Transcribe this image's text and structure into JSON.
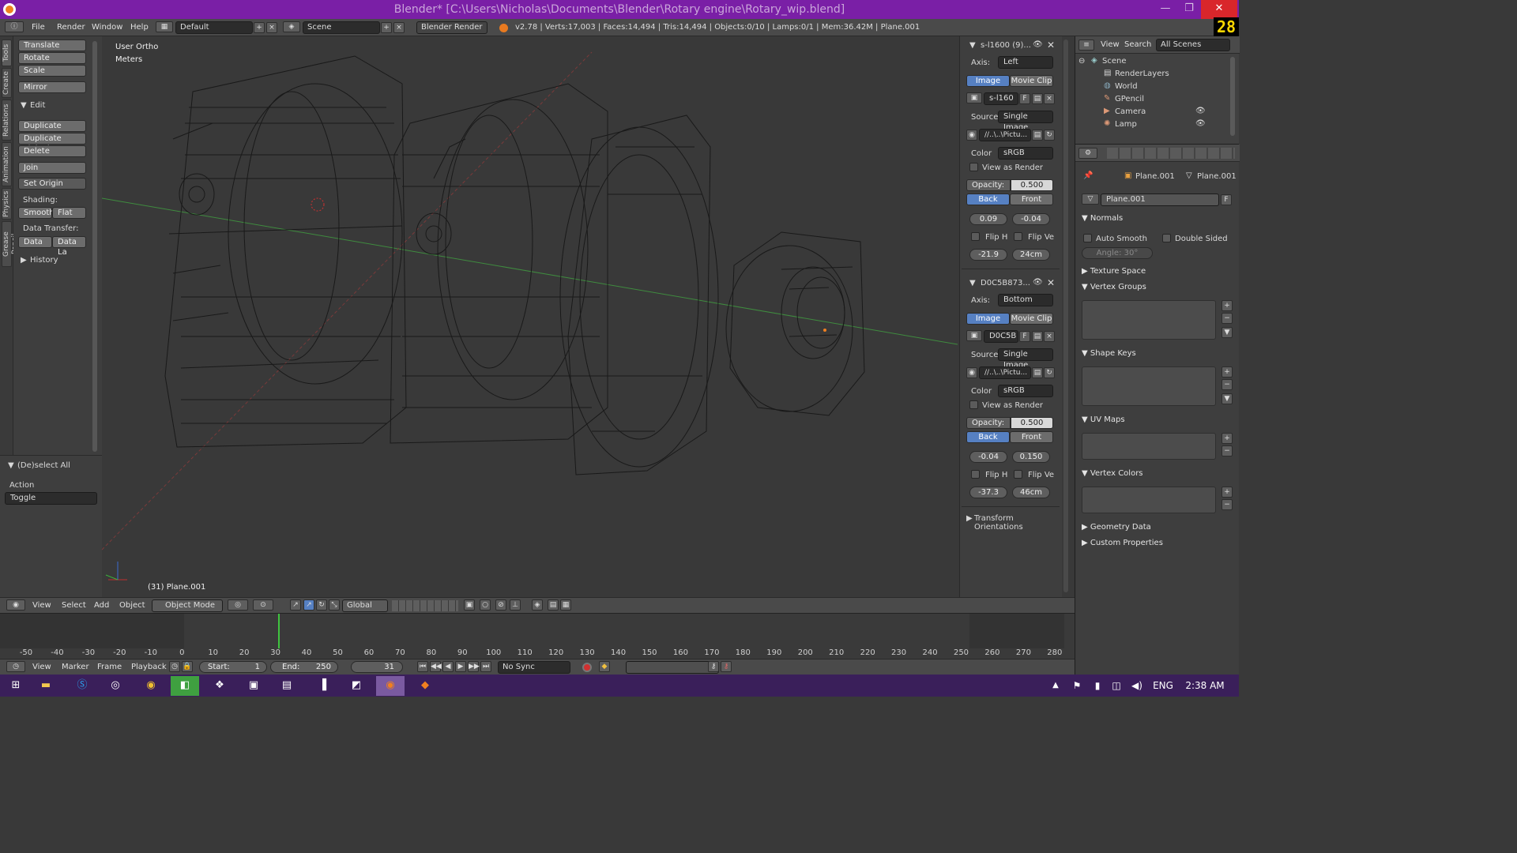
{
  "window": {
    "title": "Blender* [C:\\Users\\Nicholas\\Documents\\Blender\\Rotary engine\\Rotary_wip.blend]",
    "minimize": "—",
    "maximize": "❐",
    "close": "✕"
  },
  "infobar": {
    "menus": [
      "File",
      "Render",
      "Window",
      "Help"
    ],
    "layout": "Default",
    "scene": "Scene",
    "engine": "Blender Render",
    "stats": "v2.78 | Verts:17,003 | Faces:14,494 | Tris:14,494 | Objects:0/10 | Lamps:0/1 | Mem:36.42M | Plane.001",
    "fps": "28"
  },
  "vtabs": [
    "Tools",
    "Create",
    "Relations",
    "Animation",
    "Physics",
    "Grease Pencil"
  ],
  "toolshelf": {
    "transform": [
      "Translate",
      "Rotate",
      "Scale"
    ],
    "mirror": "Mirror",
    "edit_header": "Edit",
    "edit": [
      "Duplicate",
      "Duplicate Linked",
      "Delete"
    ],
    "join": "Join",
    "set_origin": "Set Origin",
    "shading_label": "Shading:",
    "smooth": "Smooth",
    "flat": "Flat",
    "data_transfer_label": "Data Transfer:",
    "data": "Data",
    "data_layers": "Data La",
    "history": "History"
  },
  "operator": {
    "title": "(De)select All",
    "action_label": "Action",
    "action_value": "Toggle"
  },
  "viewport": {
    "view_name": "User Ortho",
    "units": "Meters",
    "object_info": "(31) Plane.001"
  },
  "npanel": {
    "bg1": {
      "name": "s-l1600 (9)...",
      "axis_label": "Axis:",
      "axis": "Left",
      "image": "Image",
      "movie_clip": "Movie Clip",
      "img_name": "s-l160",
      "f": "F",
      "source_label": "Source",
      "source": "Single Image",
      "path": "//..\\..\\Pictu...",
      "color_label": "Color",
      "color": "sRGB",
      "view_as_render": "View as Render",
      "opacity_label": "Opacity:",
      "opacity": "0.500",
      "back": "Back",
      "front": "Front",
      "x": "0.09",
      "y": "-0.04",
      "flip_h": "Flip H",
      "flip_v": "Flip Ve",
      "rot": "-21.9",
      "size": "24cm"
    },
    "bg2": {
      "name": "D0C5B873...",
      "axis_label": "Axis:",
      "axis": "Bottom",
      "image": "Image",
      "movie_clip": "Movie Clip",
      "img_name": "D0C5B",
      "f": "F",
      "source_label": "Source",
      "source": "Single Image",
      "path": "//..\\..\\Pictu...",
      "color_label": "Color",
      "color": "sRGB",
      "view_as_render": "View as Render",
      "opacity_label": "Opacity:",
      "opacity": "0.500",
      "back": "Back",
      "front": "Front",
      "x": "-0.04",
      "y": "0.150",
      "flip_h": "Flip H",
      "flip_v": "Flip Ve",
      "rot": "-37.3",
      "size": "46cm"
    },
    "transform_orientations": "Transform Orientations"
  },
  "outliner": {
    "view": "View",
    "search": "Search",
    "filter": "All Scenes",
    "items": [
      "Scene",
      "RenderLayers",
      "World",
      "GPencil",
      "Camera",
      "Lamp"
    ]
  },
  "properties": {
    "breadcrumb1": "Plane.001",
    "breadcrumb2": "Plane.001",
    "mesh_name": "Plane.001",
    "f": "F",
    "normals": "Normals",
    "auto_smooth": "Auto Smooth",
    "double_sided": "Double Sided",
    "angle": "Angle:",
    "angle_value": "30°",
    "texture_space": "Texture Space",
    "vertex_groups": "Vertex Groups",
    "shape_keys": "Shape Keys",
    "uv_maps": "UV Maps",
    "vertex_colors": "Vertex Colors",
    "geometry_data": "Geometry Data",
    "custom_properties": "Custom Properties"
  },
  "v3dheader": {
    "menus": [
      "View",
      "Select",
      "Add",
      "Object"
    ],
    "mode": "Object Mode",
    "orientation": "Global"
  },
  "timeline": {
    "ticks": [
      "-50",
      "-40",
      "-30",
      "-20",
      "-10",
      "0",
      "10",
      "20",
      "30",
      "40",
      "50",
      "60",
      "70",
      "80",
      "90",
      "100",
      "110",
      "120",
      "130",
      "140",
      "150",
      "160",
      "170",
      "180",
      "190",
      "200",
      "210",
      "220",
      "230",
      "240",
      "250",
      "260",
      "270",
      "280"
    ],
    "current_frame_value": 31
  },
  "tlheader": {
    "menus": [
      "View",
      "Marker",
      "Frame",
      "Playback"
    ],
    "start": "Start:",
    "start_value": "1",
    "end": "End:",
    "end_value": "250",
    "current": "31",
    "sync": "No Sync"
  },
  "taskbar": {
    "lang": "ENG",
    "time": "2:38 AM"
  },
  "colors": {
    "titlebar": "#7a1fa6",
    "selected": "#5680c2",
    "timeline_cursor": "#3fc43f",
    "taskbar": "#3a1f5a"
  }
}
